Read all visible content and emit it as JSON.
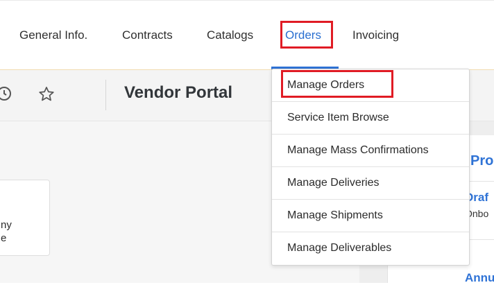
{
  "nav": {
    "items": [
      "General Info.",
      "Contracts",
      "Catalogs",
      "Orders",
      "Invoicing"
    ],
    "active": "Orders"
  },
  "shellbar": {
    "title": "Vendor Portal",
    "icons": [
      "history-icon",
      "star-icon"
    ]
  },
  "dropdown": {
    "items": [
      "Manage Orders",
      "Service Item Browse",
      "Manage Mass Confirmations",
      "Manage Deliveries",
      "Manage Shipments",
      "Manage Deliverables"
    ]
  },
  "left_card": {
    "line1": "ny",
    "line2": "e"
  },
  "right_card": {
    "title": "Pro",
    "link1": "Draf",
    "sub1": "Onbo",
    "link2": "Annu"
  },
  "colors": {
    "accent": "#2f73d6",
    "highlight": "#e01b24",
    "nav_line": "#f2dcb0"
  }
}
